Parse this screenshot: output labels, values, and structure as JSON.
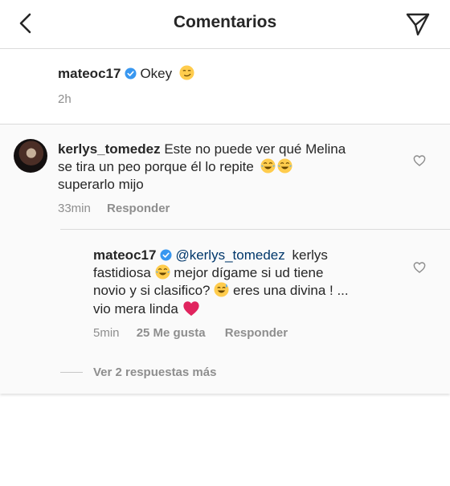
{
  "header": {
    "title": "Comentarios",
    "back_icon": "chevron-left-icon",
    "send_icon": "paper-plane-icon"
  },
  "post": {
    "username": "mateoc17",
    "text": "Okey",
    "emoji": "smirking-face",
    "time": "2h"
  },
  "comment": {
    "username": "kerlys_tomedez",
    "text_line1": "Este no puede ver qué Melina",
    "text_line2": "se tira un peo porque él lo repite",
    "text_line3": "superarlo mijo",
    "time": "33min",
    "reply_label": "Responder"
  },
  "reply": {
    "username": "mateoc17",
    "mention": "@kerlys_tomedez",
    "text_line1_end": "kerlys",
    "text_line2_a": "fastidiosa",
    "text_line2_b": "mejor dígame si ud tiene",
    "text_line3_a": "novio y si clasifico?",
    "text_line3_b": "eres una divina ! ...",
    "text_line4": "vio mera linda",
    "time": "5min",
    "likes": "25 Me gusta",
    "reply_label": "Responder",
    "view_more": "Ver 2 respuestas más"
  },
  "colors": {
    "text": "#262626",
    "secondary": "#8e8e8e",
    "verified": "#3897f0",
    "mention": "#00376b",
    "heart_emoji": "#e0245e"
  }
}
